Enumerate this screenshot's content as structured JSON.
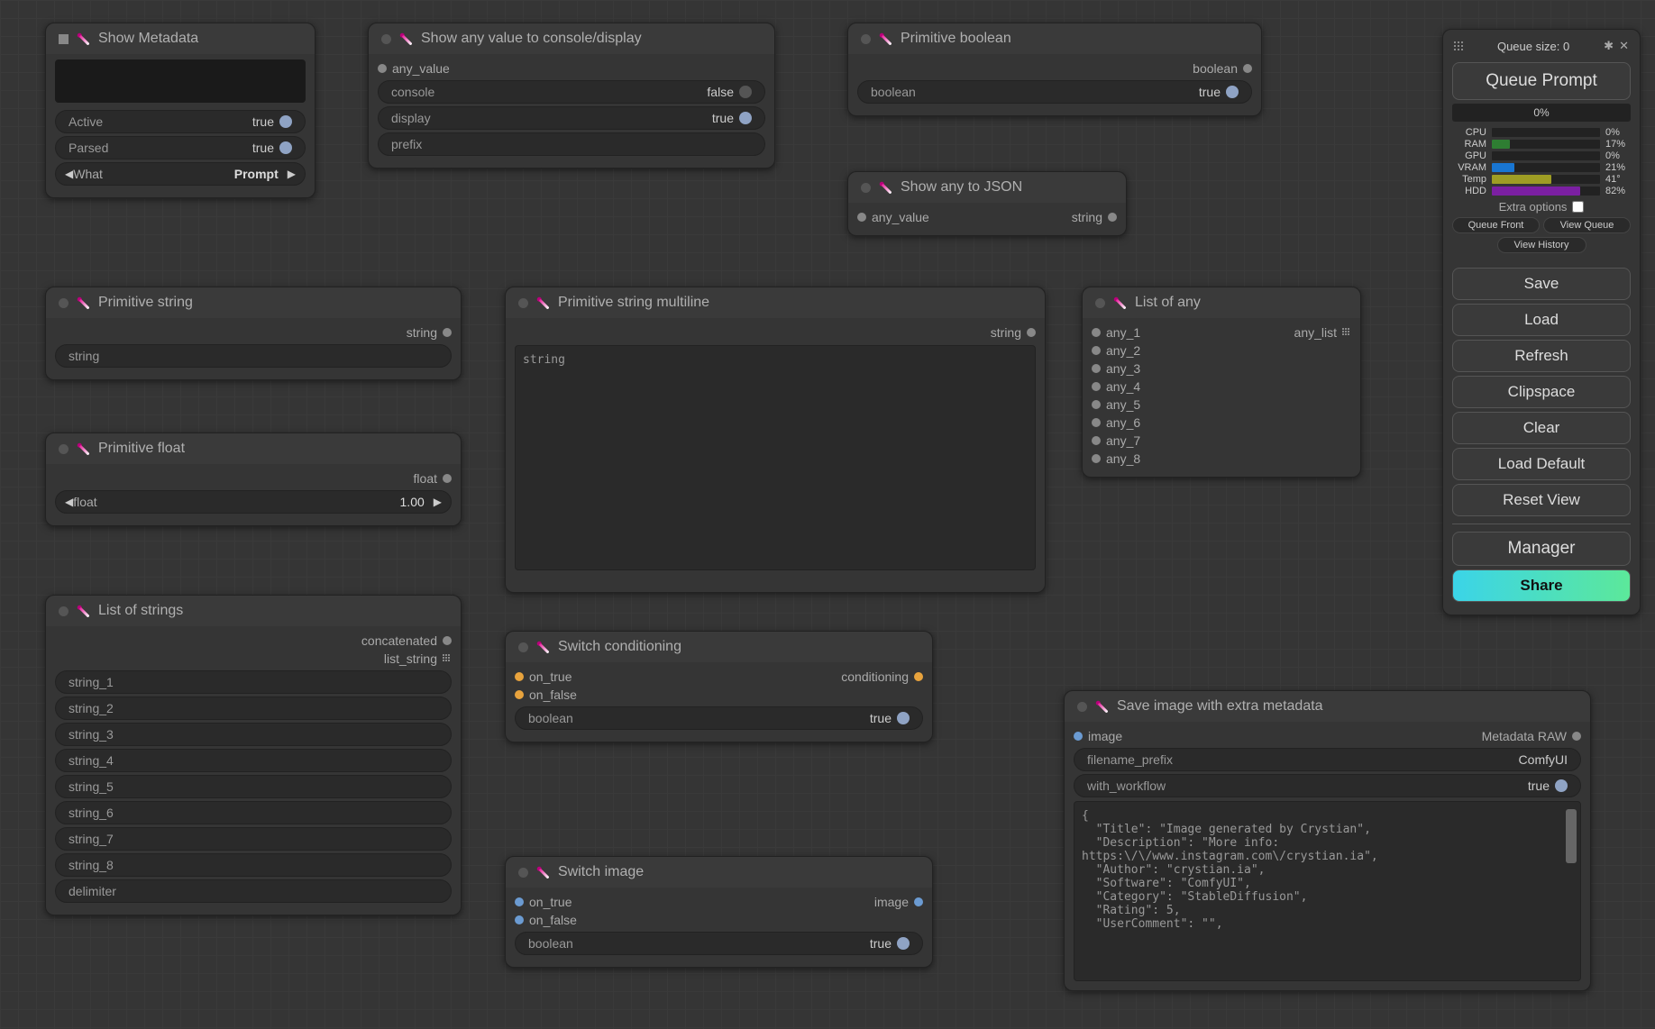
{
  "nodes": {
    "show_metadata": {
      "title": "Show Metadata",
      "widgets": {
        "active_label": "Active",
        "active_val": "true",
        "parsed_label": "Parsed",
        "parsed_val": "true",
        "what_label": "What",
        "what_val": "Prompt"
      }
    },
    "show_any_console": {
      "title": "Show any value to console/display",
      "input": "any_value",
      "widgets": {
        "console_label": "console",
        "console_val": "false",
        "display_label": "display",
        "display_val": "true",
        "prefix_label": "prefix"
      }
    },
    "prim_bool": {
      "title": "Primitive boolean",
      "output": "boolean",
      "widget_label": "boolean",
      "widget_val": "true"
    },
    "show_json": {
      "title": "Show any to JSON",
      "input": "any_value",
      "output": "string"
    },
    "prim_string": {
      "title": "Primitive string",
      "output": "string",
      "widget_label": "string"
    },
    "prim_float": {
      "title": "Primitive float",
      "output": "float",
      "widget_label": "float",
      "widget_val": "1.00"
    },
    "prim_string_ml": {
      "title": "Primitive string multiline",
      "output": "string",
      "placeholder": "string"
    },
    "list_any": {
      "title": "List of any",
      "output": "any_list",
      "inputs": [
        "any_1",
        "any_2",
        "any_3",
        "any_4",
        "any_5",
        "any_6",
        "any_7",
        "any_8"
      ]
    },
    "list_strings": {
      "title": "List of strings",
      "outputs": [
        "concatenated",
        "list_string"
      ],
      "widgets": [
        "string_1",
        "string_2",
        "string_3",
        "string_4",
        "string_5",
        "string_6",
        "string_7",
        "string_8",
        "delimiter"
      ]
    },
    "switch_cond": {
      "title": "Switch conditioning",
      "inputs": [
        "on_true",
        "on_false"
      ],
      "output": "conditioning",
      "widget_label": "boolean",
      "widget_val": "true"
    },
    "switch_image": {
      "title": "Switch image",
      "inputs": [
        "on_true",
        "on_false"
      ],
      "output": "image",
      "widget_label": "boolean",
      "widget_val": "true"
    },
    "save_image": {
      "title": "Save image with extra metadata",
      "input": "image",
      "output": "Metadata RAW",
      "widgets": {
        "prefix_label": "filename_prefix",
        "prefix_val": "ComfyUI",
        "workflow_label": "with_workflow",
        "workflow_val": "true"
      },
      "json_text": "{\n  \"Title\": \"Image generated by Crystian\",\n  \"Description\": \"More info:\nhttps:\\/\\/www.instagram.com\\/crystian.ia\",\n  \"Author\": \"crystian.ia\",\n  \"Software\": \"ComfyUI\",\n  \"Category\": \"StableDiffusion\",\n  \"Rating\": 5,\n  \"UserComment\": \"\","
    }
  },
  "sidebar": {
    "queue_size_label": "Queue size:",
    "queue_size_val": "0",
    "queue_prompt": "Queue Prompt",
    "progress": "0%",
    "stats": [
      {
        "label": "CPU",
        "val": "0%",
        "pct": 0,
        "color": "#3a3a3a"
      },
      {
        "label": "RAM",
        "val": "17%",
        "pct": 17,
        "color": "#2e7d32"
      },
      {
        "label": "GPU",
        "val": "0%",
        "pct": 0,
        "color": "#3a3a3a"
      },
      {
        "label": "VRAM",
        "val": "21%",
        "pct": 21,
        "color": "#1976d2"
      },
      {
        "label": "Temp",
        "val": "41°",
        "pct": 55,
        "color": "#9e9d24"
      },
      {
        "label": "HDD",
        "val": "82%",
        "pct": 82,
        "color": "#7b1fa2"
      }
    ],
    "extra_options": "Extra options",
    "queue_front": "Queue Front",
    "view_queue": "View Queue",
    "view_history": "View History",
    "buttons": {
      "save": "Save",
      "load": "Load",
      "refresh": "Refresh",
      "clipspace": "Clipspace",
      "clear": "Clear",
      "load_default": "Load Default",
      "reset_view": "Reset View",
      "manager": "Manager",
      "share": "Share"
    }
  }
}
